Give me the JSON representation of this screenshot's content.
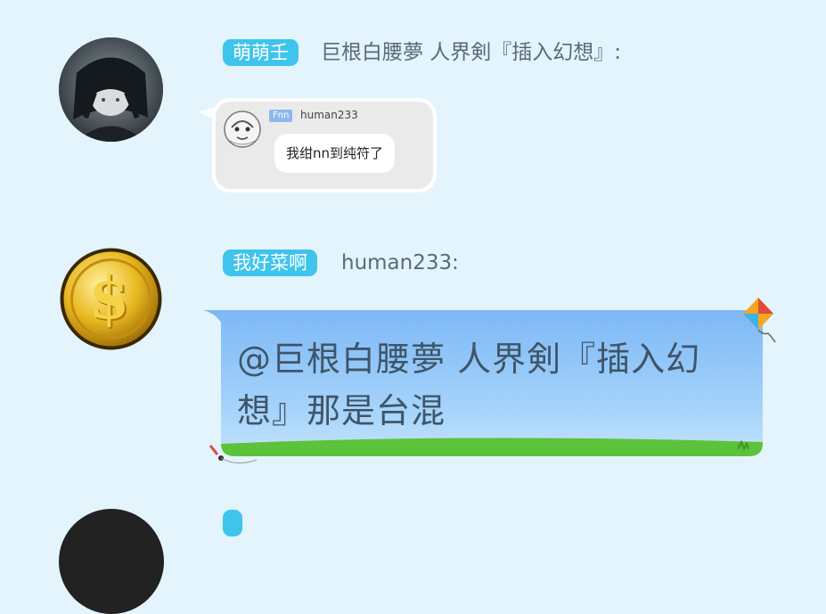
{
  "messages": [
    {
      "avatar": "dark-haired-anime-character-avatar",
      "tag": "萌萌壬",
      "sender": "巨根白腰夢 人界剣『插入幻想』:",
      "image_content": {
        "mini_tag": "Fnn",
        "mini_name": "human233",
        "mini_text": "我绀nn到纯符了"
      }
    },
    {
      "avatar": "gold-dollar-coin-avatar",
      "tag": "我好菜啊",
      "sender": "human233:",
      "text": "@巨根白腰夢 人界剣『插入幻想』那是台混"
    },
    {
      "avatar": "dark-avatar-partial",
      "tag": ""
    }
  ],
  "colors": {
    "background": "#e3f4fd",
    "tag": "#3fc4ec",
    "sky_bubble_top": "#7ab7f7",
    "grass": "#5cc23a"
  }
}
